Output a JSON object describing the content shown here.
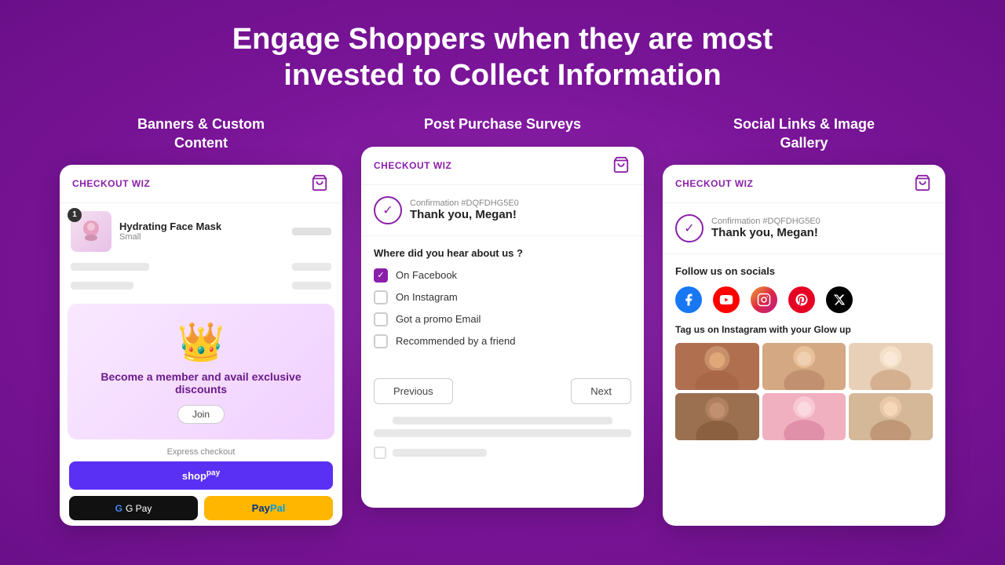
{
  "headline": {
    "line1": "Engage Shoppers when they are most",
    "line2": "invested to Collect Information"
  },
  "columns": [
    {
      "id": "banners",
      "title": "Banners & Custom\nContent",
      "card": {
        "brand": "CHECKOUT WIZ",
        "product": {
          "name": "Hydrating Face Mask",
          "variant": "Small",
          "badge": "1"
        },
        "banner": {
          "text": "Become a member and avail exclusive discounts",
          "join_label": "Join"
        },
        "express_label": "Express checkout",
        "shop_pay_label": "shop",
        "gpay_label": "G Pay",
        "paypal_label": "PayPal"
      }
    },
    {
      "id": "surveys",
      "title": "Post Purchase Surveys",
      "card": {
        "brand": "CHECKOUT WIZ",
        "confirmation_number": "Confirmation #DQFDHG5E0",
        "thank_you": "Thank you, Megan!",
        "question": "Where did you hear about us ?",
        "options": [
          {
            "label": "On Facebook",
            "checked": true
          },
          {
            "label": "On Instagram",
            "checked": false
          },
          {
            "label": "Got a promo Email",
            "checked": false
          },
          {
            "label": "Recommended by a friend",
            "checked": false
          }
        ],
        "prev_label": "Previous",
        "next_label": "Next"
      }
    },
    {
      "id": "social",
      "title": "Social Links & Image\nGallery",
      "card": {
        "brand": "CHECKOUT WIZ",
        "confirmation_number": "Confirmation #DQFDHG5E0",
        "thank_you": "Thank you, Megan!",
        "follow_title": "Follow us on socials",
        "tag_title": "Tag us on Instagram with your Glow up",
        "socials": [
          "facebook",
          "youtube",
          "instagram",
          "pinterest",
          "twitter-x"
        ]
      }
    }
  ]
}
